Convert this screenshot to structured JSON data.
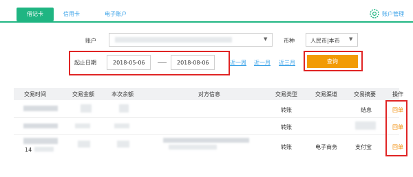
{
  "tabs": [
    {
      "label": "借记卡"
    },
    {
      "label": "信用卡"
    },
    {
      "label": "电子账户"
    }
  ],
  "account_manage": {
    "label": "账户管理",
    "icon": "gear-icon"
  },
  "form": {
    "account_label": "账户",
    "currency_label": "币种",
    "currency_value": "人民币|本币",
    "date_label": "起止日期",
    "start_date": "2018-05-06",
    "end_date": "2018-08-06",
    "quick_ranges": [
      "近一周",
      "近一月",
      "近三月"
    ],
    "query_button": "查询"
  },
  "table": {
    "headers": [
      "交易时间",
      "交易金额",
      "本次余额",
      "对方信息",
      "交易类型",
      "交易渠道",
      "交易摘要",
      "操作"
    ],
    "rows": [
      {
        "type": "转账",
        "channel": "",
        "summary": "结息",
        "action": "回单"
      },
      {
        "type": "转账",
        "channel": "",
        "summary": "",
        "action": "回单"
      },
      {
        "type": "转账",
        "channel": "电子商务",
        "summary": "支付宝",
        "action": "回单",
        "time_fragment": "14"
      }
    ]
  },
  "colors": {
    "brand_green": "#1fb582",
    "link_blue": "#3aa2e8",
    "button_orange": "#f29b05",
    "highlight_red": "#e02424"
  }
}
